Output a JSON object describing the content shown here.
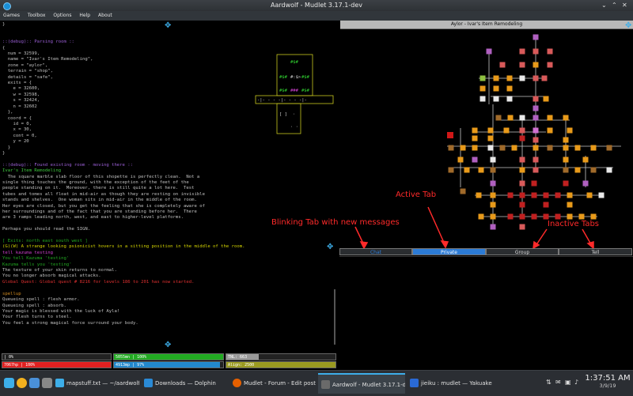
{
  "window": {
    "title": "Aardwolf - Mudlet 3.17.1-dev"
  },
  "menu": [
    "Games",
    "Toolbox",
    "Options",
    "Help",
    "About"
  ],
  "console": {
    "lines": [
      {
        "t": "}",
        "c": ""
      },
      {
        "t": "",
        "c": ""
      },
      {
        "t": "",
        "c": ""
      },
      {
        "t": "::(debug):: Parsing room ::",
        "c": "c-purple"
      },
      {
        "t": "{",
        "c": ""
      },
      {
        "t": "  num = 32599,",
        "c": ""
      },
      {
        "t": "  name = \"Ivar's Item Remodeling\",",
        "c": ""
      },
      {
        "t": "  zone = \"aylor\",",
        "c": ""
      },
      {
        "t": "  terrain = \"shop\",",
        "c": ""
      },
      {
        "t": "  details = \"safe\",",
        "c": ""
      },
      {
        "t": "  exits = {",
        "c": ""
      },
      {
        "t": "    e = 32600,",
        "c": ""
      },
      {
        "t": "    w = 32598,",
        "c": ""
      },
      {
        "t": "    s = 32424,",
        "c": ""
      },
      {
        "t": "    n = 32602",
        "c": ""
      },
      {
        "t": "  },",
        "c": ""
      },
      {
        "t": "  coord = {",
        "c": ""
      },
      {
        "t": "    id = 0,",
        "c": ""
      },
      {
        "t": "    x = 30,",
        "c": ""
      },
      {
        "t": "    cont = 0,",
        "c": ""
      },
      {
        "t": "    y = 20",
        "c": ""
      },
      {
        "t": "  }",
        "c": ""
      },
      {
        "t": "}",
        "c": ""
      },
      {
        "t": "",
        "c": ""
      },
      {
        "t": "::(debug):: Found existing room - moving there ::",
        "c": "c-purple"
      },
      {
        "t": "Ivar's Item Remodeling",
        "c": "c-green"
      },
      {
        "t": "  The square marble slab floor of this shopette is perfectly clean.  Not a",
        "c": ""
      },
      {
        "t": "single thing touches the ground, with the exception of the feet of the",
        "c": ""
      },
      {
        "t": "people standing on it.  Moreover, there is still quite a lot here.  Test",
        "c": ""
      },
      {
        "t": "tubes and tomes all float in mid-air as though they are resting on invisible",
        "c": ""
      },
      {
        "t": "stands and shelves.  One woman sits in mid-air in the middle of the room.",
        "c": ""
      },
      {
        "t": "Her eyes are closed, but you get the feeling that she is completely aware of",
        "c": ""
      },
      {
        "t": "her surroundings and of the fact that you are standing before her.  There",
        "c": ""
      },
      {
        "t": "are 3 ramps leading north, west, and east to higher-level platforms.",
        "c": ""
      },
      {
        "t": "",
        "c": ""
      },
      {
        "t": "Perhaps you should read the SIGN.",
        "c": ""
      },
      {
        "t": "",
        "c": ""
      },
      {
        "t": "[ Exits: north east south west ]",
        "c": "c-dgreen"
      },
      {
        "t": "(G)(W) A strange looking psionicist hovers in a sitting position in the middle of the room.",
        "c": "c-yellow"
      },
      {
        "t": "tell kazuma testing",
        "c": "c-magenta"
      },
      {
        "t": "You tell Kazuma 'testing'",
        "c": "c-dgreen"
      },
      {
        "t": "Kazuma tells you 'testing'",
        "c": "c-dgreen"
      },
      {
        "t": "The texture of your skin returns to normal.",
        "c": ""
      },
      {
        "t": "You no longer absorb magical attacks.",
        "c": ""
      },
      {
        "t": "Global Quest: Global quest # 8216 for levels 186 to 201 has now started.",
        "c": "c-red"
      },
      {
        "t": "",
        "c": ""
      },
      {
        "t": "spellup",
        "c": "c-orange"
      },
      {
        "t": "Queueing spell : flesh armor.",
        "c": ""
      },
      {
        "t": "Queueing spell : absorb.",
        "c": ""
      },
      {
        "t": "Your magic is blessed with the luck of Ayla!",
        "c": ""
      },
      {
        "t": "Your flesh turns to steel.",
        "c": ""
      },
      {
        "t": "You feel a strong magical force surround your body.",
        "c": ""
      }
    ]
  },
  "minimap": {
    "rows": [
      "#$#",
      "#$#  #:$>  #$#",
      "#$#  ###  #$#",
      "-|- - - -|- - - -|-",
      "[ ]  ·",
      "·  ·"
    ]
  },
  "map": {
    "title": "Aylor - Ivar's Item Remodeling"
  },
  "annotations": {
    "active_tab": "Active Tab",
    "blinking_tab": "Blinking Tab with new messages",
    "inactive_tabs": "Inactive Tabs"
  },
  "tabs": [
    {
      "label": "Chat",
      "state": "blinking"
    },
    {
      "label": "Private",
      "state": "active"
    },
    {
      "label": "Group",
      "state": "inactive"
    },
    {
      "label": "Tell",
      "state": "inactive"
    }
  ],
  "gauges": {
    "xp": {
      "label": "| 0%",
      "fill": 0.0,
      "color": "#888888"
    },
    "mana": {
      "label": "5055mn | 100%",
      "fill": 1.0,
      "color": "#22aa22"
    },
    "tnl": {
      "label": "TNL: 663",
      "fill": 0.3,
      "color": "#999999"
    },
    "hp": {
      "label": "7067hp | 100%",
      "fill": 1.0,
      "color": "#e02020"
    },
    "moves": {
      "label": "4913mp | 97%",
      "fill": 0.97,
      "color": "#2288cc"
    },
    "align": {
      "label": "Align: 2500",
      "fill": 1.0,
      "color": "#9a9a20"
    }
  },
  "taskbar": {
    "tasks": [
      {
        "label": "mapstuff.txt — ~/aardwolf — Kate",
        "icon_color": "#3daee9",
        "active": false
      },
      {
        "label": "Downloads — Dolphin",
        "icon_color": "#2a8ad6",
        "active": false
      },
      {
        "label": "Mudlet - Forum - Edit post - M...",
        "icon_color": "#e66000",
        "active": false
      },
      {
        "label": "Aardwolf - Mudlet 3.17.1-dev",
        "icon_color": "#6a6a6a",
        "active": true
      },
      {
        "label": "jieiku : mudlet — Yakuake",
        "icon_color": "#2a6ad6",
        "active": false
      }
    ],
    "time": "1:37:51 AM",
    "date": "3/9/19"
  }
}
